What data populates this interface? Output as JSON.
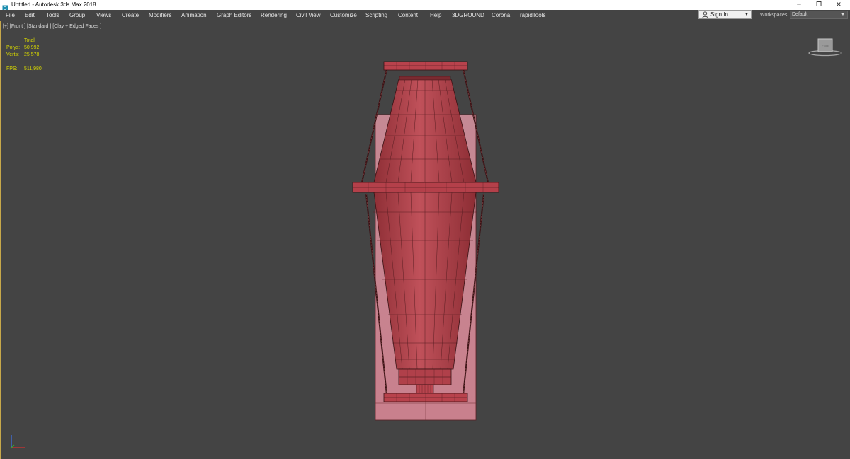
{
  "window": {
    "title": "Untitled - Autodesk 3ds Max 2018",
    "controls": {
      "minimize": "─",
      "restore": "❐",
      "close": "✕"
    }
  },
  "menu": {
    "items": [
      "File",
      "Edit",
      "Tools",
      "Group",
      "Views",
      "Create",
      "Modifiers",
      "Animation",
      "Graph Editors",
      "Rendering",
      "Civil View",
      "Customize",
      "Scripting",
      "Content",
      "Help",
      "3DGROUND",
      "Corona",
      "rapidTools"
    ]
  },
  "signin": {
    "label": "Sign In",
    "icon": "user-icon"
  },
  "workspaces": {
    "label": "Workspaces:",
    "value": "Default"
  },
  "viewport": {
    "label": "[+] [Front ] [Standard ] [Clay + Edged Faces ]",
    "stats": {
      "header": "Total",
      "polys_label": "Polys:",
      "polys_value": "50 992",
      "verts_label": "Verts:",
      "verts_value": "25 578",
      "fps_label": "FPS:",
      "fps_value": "511,980"
    },
    "viewcube_label": "Front"
  },
  "colors": {
    "viewport_bg": "#444444",
    "accent_border": "#c7a84a",
    "stats_text": "#d7d700",
    "model_fill": "#b0404a",
    "model_back": "#c98d96",
    "wire": "#3a1214"
  }
}
